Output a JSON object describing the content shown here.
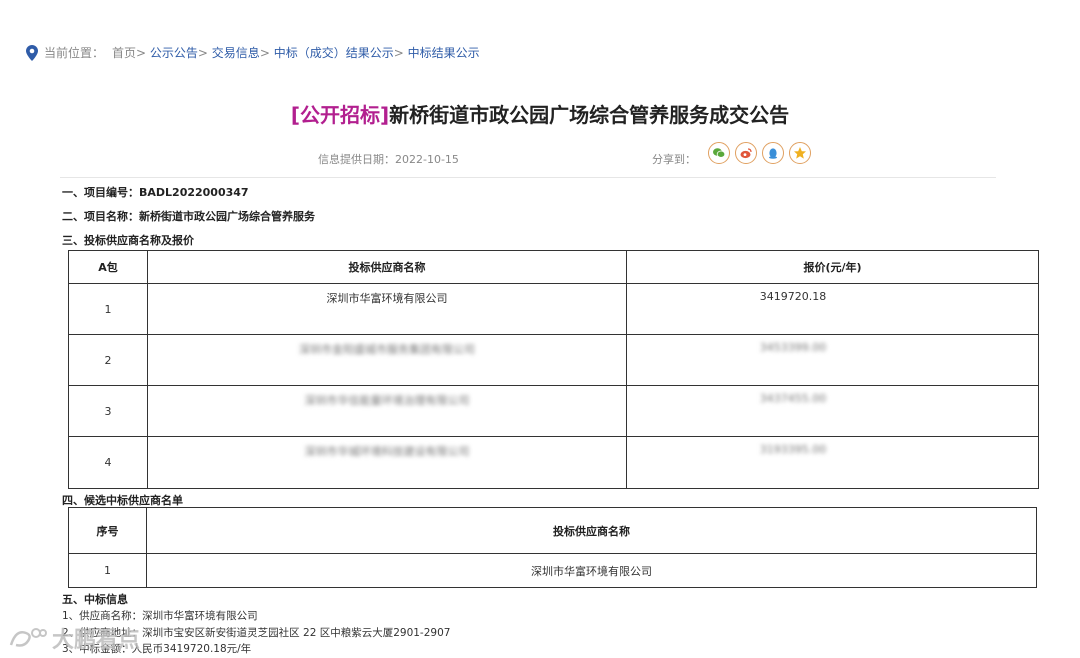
{
  "breadcrumb": {
    "label": "当前位置：",
    "home": "首页",
    "items": [
      "公示公告",
      "交易信息",
      "中标（成交）结果公示",
      "中标结果公示"
    ]
  },
  "title": {
    "tag": "[公开招标]",
    "text": "新桥街道市政公园广场综合管养服务成交公告"
  },
  "meta": {
    "date_label": "信息提供日期：2022-10-15",
    "share_label": "分享到："
  },
  "share_icons": [
    "wechat-icon",
    "weibo-icon",
    "qq-icon",
    "qzone-icon"
  ],
  "sections": {
    "s1": "一、项目编号：BADL2022000347",
    "s2": "二、项目名称：新桥街道市政公园广场综合管养服务",
    "s3": "三、投标供应商名称及报价",
    "s4": "四、候选中标供应商名单",
    "s5": "五、中标信息"
  },
  "bid_table": {
    "headers": [
      "A包",
      "投标供应商名称",
      "报价(元/年)"
    ],
    "rows": [
      {
        "no": "1",
        "name": "深圳市华富环境有限公司",
        "price": "3419720.18"
      },
      {
        "no": "2",
        "name": "深圳市金阳盛城市服务集团有限公司",
        "price": "3453399.00"
      },
      {
        "no": "3",
        "name": "深圳市华信能量环境治理有限公司",
        "price": "3437455.00"
      },
      {
        "no": "4",
        "name": "深圳市华城环境科技建设有限公司",
        "price": "3193395.00"
      }
    ]
  },
  "candidate_table": {
    "headers": [
      "序号",
      "投标供应商名称"
    ],
    "rows": [
      {
        "no": "1",
        "name": "深圳市华富环境有限公司"
      }
    ]
  },
  "award": {
    "l1": "1、供应商名称：深圳市华富环境有限公司",
    "l2": "2、供应商地址：深圳市宝安区新安街道灵芝园社区 22 区中粮紫云大厦2901-2907",
    "l3": "3、中标金额：人民币3419720.18元/年"
  },
  "watermark": "大鹏看点"
}
